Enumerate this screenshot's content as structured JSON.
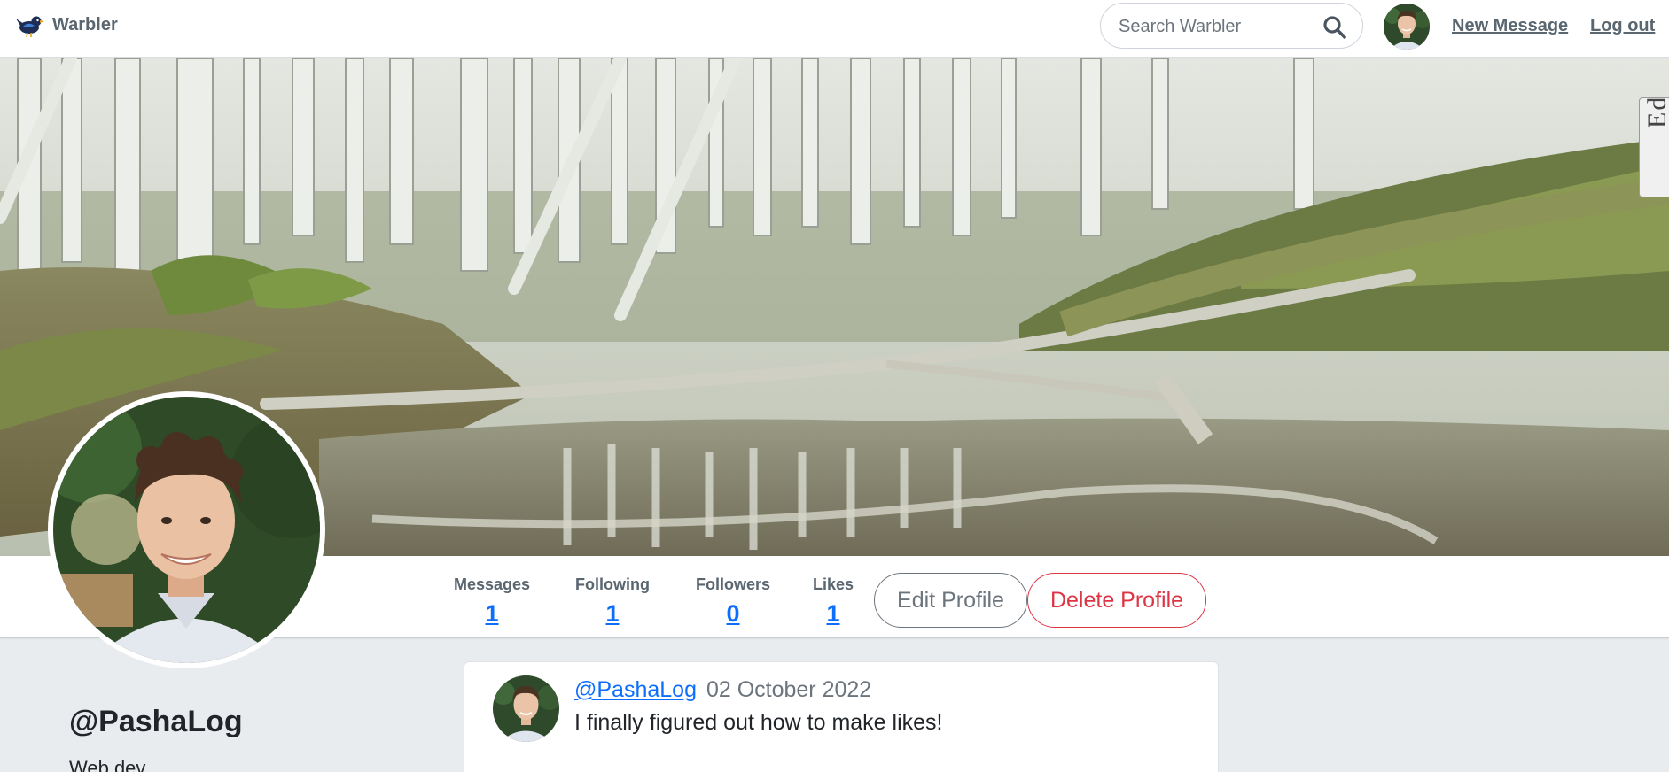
{
  "colors": {
    "link": "#0d6efd",
    "nav_text": "#5a6670",
    "danger": "#dc3545",
    "secondary": "#6c757d",
    "page_bg": "#e9ecef"
  },
  "navbar": {
    "brand": "Warbler",
    "logo_icon": "bird-icon",
    "search_placeholder": "Search Warbler",
    "search_icon": "search-icon",
    "new_message": "New Message",
    "logout": "Log out"
  },
  "hero": {
    "image": "forest-creek-photo",
    "edit_tab": "Edit"
  },
  "stats": [
    {
      "label": "Messages",
      "value": "1"
    },
    {
      "label": "Following",
      "value": "1"
    },
    {
      "label": "Followers",
      "value": "0"
    },
    {
      "label": "Likes",
      "value": "1"
    }
  ],
  "actions": {
    "edit_profile": "Edit Profile",
    "delete_profile": "Delete Profile"
  },
  "profile": {
    "username": "@PashaLog",
    "bio": "Web dev"
  },
  "messages": [
    {
      "user": "@PashaLog",
      "date": "02 October 2022",
      "text": "I finally figured out how to make likes!"
    }
  ]
}
